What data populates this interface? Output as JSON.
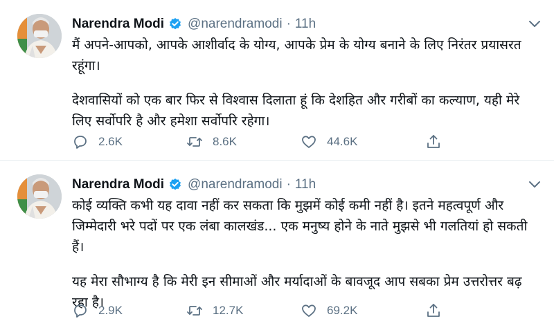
{
  "tweets": [
    {
      "author": {
        "name": "Narendra Modi",
        "handle": "@narendramodi",
        "verified": true
      },
      "separator": "·",
      "time": "11h",
      "paragraphs": [
        "मैं अपने-आपको, आपके आशीर्वाद के योग्य, आपके प्रेम के योग्य बनाने के लिए निरंतर प्रयासरत रहूंगा।",
        "देशवासियों को एक बार फिर से विश्वास दिलाता हूं कि देशहित और गरीबों का कल्याण, यही मेरे लिए सर्वोपरि है और हमेशा सर्वोपरि रहेगा।"
      ],
      "actions": {
        "replies": "2.6K",
        "retweets": "8.6K",
        "likes": "44.6K"
      }
    },
    {
      "author": {
        "name": "Narendra Modi",
        "handle": "@narendramodi",
        "verified": true
      },
      "separator": "·",
      "time": "11h",
      "paragraphs": [
        "कोई व्यक्ति कभी यह दावा नहीं कर सकता कि मुझमें कोई कमी नहीं है। इतने महत्वपूर्ण और जिम्मेदारी भरे पदों पर एक लंबा कालखंड... एक मनुष्य होने के नाते मुझसे भी गलतियां हो सकती हैं।",
        "यह मेरा सौभाग्य है कि मेरी इन सीमाओं और मर्यादाओं के बावजूद आप सबका प्रेम उत्तरोत्तर बढ़ रहा है।"
      ],
      "actions": {
        "replies": "2.9K",
        "retweets": "12.7K",
        "likes": "69.2K"
      }
    }
  ],
  "colors": {
    "accent": "#1da1f2",
    "secondary_text": "#5b7083",
    "divider": "#e6ecf0"
  },
  "icons": [
    "avatar",
    "verified-badge-icon",
    "caret-down-icon",
    "reply-icon",
    "retweet-icon",
    "like-icon",
    "share-icon"
  ]
}
